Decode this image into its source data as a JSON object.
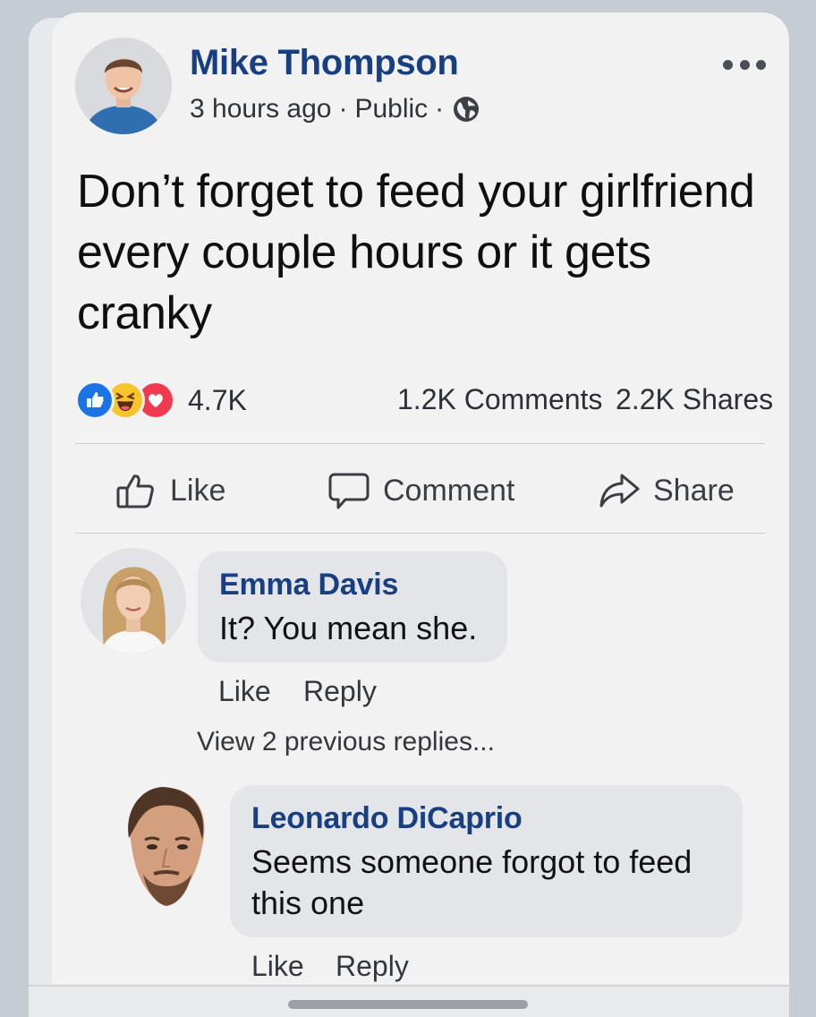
{
  "post": {
    "author": "Mike Thompson",
    "time": "3 hours ago",
    "separator": "·",
    "audience": "Public",
    "audience_icon": "globe-icon",
    "body": "Don’t forget to feed your girlfriend every couple hours or it gets cranky",
    "menu_icon": "more-icon"
  },
  "stats": {
    "reactions": [
      "like",
      "haha",
      "love"
    ],
    "reaction_count": "4.7K",
    "comments": "1.2K Comments",
    "shares": "2.2K Shares"
  },
  "actions": {
    "like": "Like",
    "comment": "Comment",
    "share": "Share"
  },
  "comments": [
    {
      "name": "Emma Davis",
      "text": "It? You mean she.",
      "like": "Like",
      "reply": "Reply"
    }
  ],
  "view_replies": "View 2 previous replies...",
  "replies": [
    {
      "name": "Leonardo DiCaprio",
      "text": "Seems someone forgot to feed this one",
      "like": "Like",
      "reply": "Reply"
    }
  ],
  "colors": {
    "name_blue": "#173f82",
    "like_blue": "#1b74e4",
    "love_red": "#ef3a4f",
    "haha_yellow": "#f7c42c",
    "card_bg": "#f2f2f3",
    "bubble_bg": "#e3e5e9"
  }
}
